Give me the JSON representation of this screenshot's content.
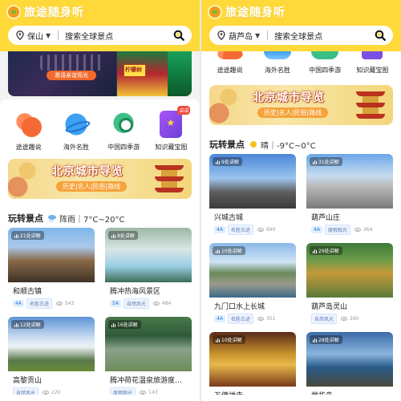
{
  "app": {
    "title": "旅途随身听",
    "brand_color": "#ffd83a"
  },
  "left_screen": {
    "search": {
      "city": "保山",
      "placeholder": "搜索全球景点"
    },
    "carousel": {
      "pill_text": "邀请亲谊观光",
      "sign_text": "柠檬树"
    },
    "categories": [
      {
        "label": "途途趣说",
        "icon": "trip-icon"
      },
      {
        "label": "海外名胜",
        "icon": "globe-icon"
      },
      {
        "label": "中国四季游",
        "icon": "season-icon"
      },
      {
        "label": "知识藏宝图",
        "icon": "book-icon",
        "tag": "讲讲"
      }
    ],
    "banner": {
      "title": "北京城市导览",
      "subtitle": "历史|名人|民俗|路线"
    },
    "section": {
      "title": "玩转景点",
      "weather": "阵雨｜7°C~20°C"
    },
    "spots": [
      {
        "name": "和顺古镇",
        "badge": "21处讲解",
        "level": "4A",
        "type": "名胜古迹",
        "views": "543"
      },
      {
        "name": "腾冲热海风景区",
        "badge": "8处讲解",
        "level": "5A",
        "type": "自然风光",
        "views": "484"
      },
      {
        "name": "高黎贡山",
        "badge": "12处讲解",
        "level": "",
        "type": "自然风光",
        "views": "220"
      },
      {
        "name": "腾冲荷花温泉旅游度…",
        "badge": "16处讲解",
        "level": "",
        "type": "度假观光",
        "views": "143"
      }
    ]
  },
  "right_screen": {
    "search": {
      "city": "葫芦岛",
      "placeholder": "搜索全球景点"
    },
    "categories": [
      {
        "label": "途途趣说",
        "icon": "trip-icon"
      },
      {
        "label": "海外名胜",
        "icon": "globe-icon"
      },
      {
        "label": "中国四季游",
        "icon": "season-icon"
      },
      {
        "label": "知识藏宝图",
        "icon": "book-icon"
      }
    ],
    "banner": {
      "title": "北京城市导览",
      "subtitle": "历史|名人|民俗|路线"
    },
    "section": {
      "title": "玩转景点",
      "weather": "晴｜-9°C~0°C"
    },
    "spots": [
      {
        "name": "兴城古城",
        "badge": "9处讲解",
        "level": "4A",
        "type": "名胜古迹",
        "views": "690"
      },
      {
        "name": "葫芦山庄",
        "badge": "31处讲解",
        "level": "4A",
        "type": "度假观光",
        "views": "364"
      },
      {
        "name": "九门口水上长城",
        "badge": "10处讲解",
        "level": "4A",
        "type": "名胜古迹",
        "views": "351"
      },
      {
        "name": "葫芦岛灵山",
        "badge": "29处讲解",
        "level": "",
        "type": "自然风光",
        "views": "260"
      },
      {
        "name": "万佛禅寺",
        "badge": "10处讲解",
        "level": "",
        "type": "",
        "views": ""
      },
      {
        "name": "觉华岛",
        "badge": "28处讲解",
        "level": "",
        "type": "",
        "views": ""
      }
    ]
  }
}
